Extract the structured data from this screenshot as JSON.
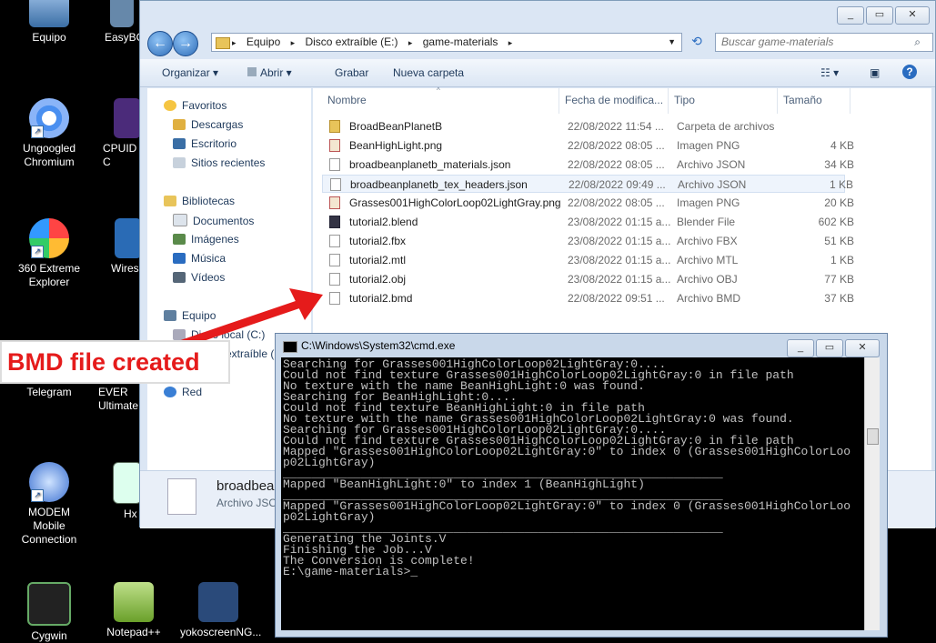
{
  "desktop": {
    "icons": [
      {
        "label": "Equipo"
      },
      {
        "label": "EasyBC"
      },
      {
        "label": "Ungoogled Chromium"
      },
      {
        "label": "CPUID C"
      },
      {
        "label": "360 Extreme Explorer"
      },
      {
        "label": "Wires"
      },
      {
        "label": "Telegram"
      },
      {
        "label": "EVER Ultimate"
      },
      {
        "label": "MODEM Mobile Connection"
      },
      {
        "label": "Hx"
      },
      {
        "label": "Cygwin"
      },
      {
        "label": "Notepad++"
      },
      {
        "label": "yokoscreenNG..."
      }
    ]
  },
  "annotation": {
    "label": "BMD file created",
    "color": "#e51b1b"
  },
  "explorer": {
    "address": {
      "crumbs": [
        "Equipo",
        "Disco extraíble (E:)",
        "game-materials"
      ],
      "search_placeholder": "Buscar game-materials"
    },
    "toolbar": {
      "organize": "Organizar",
      "open": "Abrir",
      "burn": "Grabar",
      "new_folder": "Nueva carpeta"
    },
    "nav": {
      "favorites": "Favoritos",
      "downloads": "Descargas",
      "desktop": "Escritorio",
      "recent": "Sitios recientes",
      "libraries": "Bibliotecas",
      "documents": "Documentos",
      "images": "Imágenes",
      "music": "Música",
      "videos": "Vídeos",
      "computer": "Equipo",
      "local_disk": "Disco local (C:)",
      "removable": "extraíble (E",
      "network": "Red"
    },
    "columns": {
      "name": "Nombre",
      "date": "Fecha de modifica...",
      "type": "Tipo",
      "size": "Tamaño"
    },
    "files": [
      {
        "name": "BroadBeanPlanetB",
        "date": "22/08/2022 11:54 ...",
        "type": "Carpeta de archivos",
        "size": "",
        "icon": "folder"
      },
      {
        "name": "BeanHighLight.png",
        "date": "22/08/2022 08:05 ...",
        "type": "Imagen PNG",
        "size": "4 KB",
        "icon": "image"
      },
      {
        "name": "broadbeanplanetb_materials.json",
        "date": "22/08/2022 08:05 ...",
        "type": "Archivo JSON",
        "size": "34 KB",
        "icon": "json"
      },
      {
        "name": "broadbeanplanetb_tex_headers.json",
        "date": "22/08/2022 09:49 ...",
        "type": "Archivo JSON",
        "size": "1 KB",
        "icon": "json"
      },
      {
        "name": "Grasses001HighColorLoop02LightGray.png",
        "date": "22/08/2022 08:05 ...",
        "type": "Imagen PNG",
        "size": "20 KB",
        "icon": "image"
      },
      {
        "name": "tutorial2.blend",
        "date": "23/08/2022 01:15 a...",
        "type": "Blender File",
        "size": "602 KB",
        "icon": "blend"
      },
      {
        "name": "tutorial2.fbx",
        "date": "23/08/2022 01:15 a...",
        "type": "Archivo FBX",
        "size": "51 KB",
        "icon": "doc"
      },
      {
        "name": "tutorial2.mtl",
        "date": "23/08/2022 01:15 a...",
        "type": "Archivo MTL",
        "size": "1 KB",
        "icon": "doc"
      },
      {
        "name": "tutorial2.obj",
        "date": "23/08/2022 01:15 a...",
        "type": "Archivo OBJ",
        "size": "77 KB",
        "icon": "doc"
      },
      {
        "name": "tutorial2.bmd",
        "date": "22/08/2022 09:51 ...",
        "type": "Archivo BMD",
        "size": "37 KB",
        "icon": "doc"
      }
    ],
    "details": {
      "name": "broadbear",
      "type": "Archivo JSO"
    }
  },
  "cmd": {
    "title": "C:\\Windows\\System32\\cmd.exe",
    "lines": [
      "Searching for Grasses001HighColorLoop02LightGray:0....",
      "Could not find texture Grasses001HighColorLoop02LightGray:0 in file path",
      "No texture with the name BeanHighLight:0 was found.",
      "Searching for BeanHighLight:0....",
      "Could not find texture BeanHighLight:0 in file path",
      "No texture with the name Grasses001HighColorLoop02LightGray:0 was found.",
      "Searching for Grasses001HighColorLoop02LightGray:0....",
      "Could not find texture Grasses001HighColorLoop02LightGray:0 in file path",
      "Mapped \"Grasses001HighColorLoop02LightGray:0\" to index 0 (Grasses001HighColorLoo",
      "p02LightGray)",
      "______________________________________________________________",
      "Mapped \"BeanHighLight:0\" to index 1 (BeanHighLight)",
      "______________________________________________________________",
      "Mapped \"Grasses001HighColorLoop02LightGray:0\" to index 0 (Grasses001HighColorLoo",
      "p02LightGray)",
      "______________________________________________________________",
      "",
      "Generating the Joints.V",
      "",
      "Finishing the Job...V",
      "",
      "The Conversion is complete!",
      "",
      "",
      "E:\\game-materials>_"
    ]
  }
}
